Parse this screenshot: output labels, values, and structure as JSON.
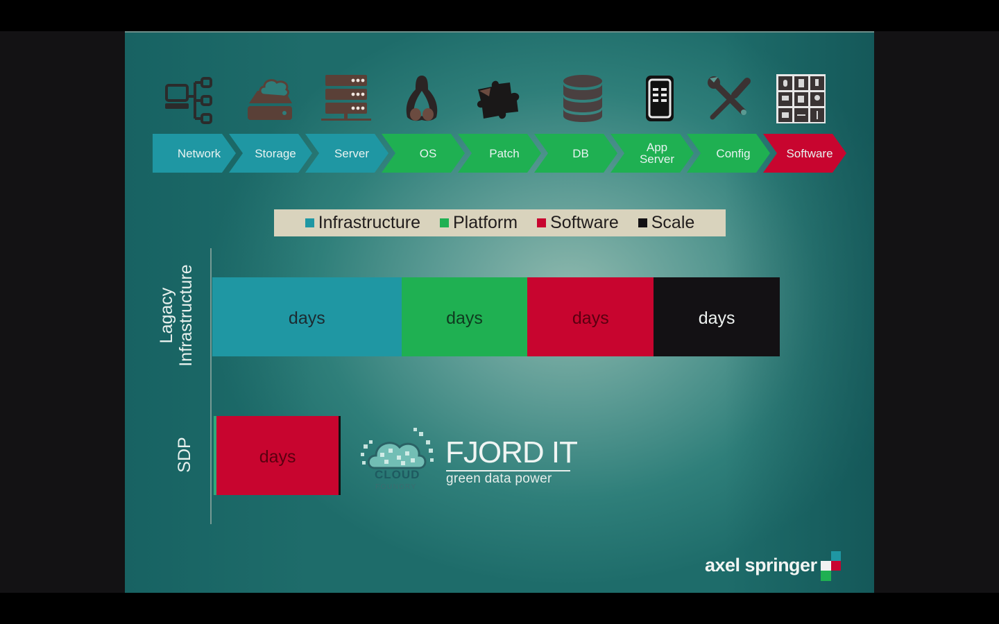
{
  "slide": {
    "process_steps": [
      {
        "label": "Network",
        "icon": "network-tree-icon",
        "category": "Infrastructure"
      },
      {
        "label": "Storage",
        "icon": "cloud-storage-icon",
        "category": "Infrastructure"
      },
      {
        "label": "Server",
        "icon": "server-rack-icon",
        "category": "Infrastructure"
      },
      {
        "label": "OS",
        "icon": "linux-penguin-icon",
        "category": "Platform"
      },
      {
        "label": "Patch",
        "icon": "puzzle-piece-icon",
        "category": "Platform"
      },
      {
        "label": "DB",
        "icon": "database-icon",
        "category": "Platform"
      },
      {
        "label_line1": "App",
        "label_line2": "Server",
        "icon": "mobile-app-icon",
        "category": "Platform"
      },
      {
        "label": "Config",
        "icon": "wrench-screwdriver-icon",
        "category": "Platform"
      },
      {
        "label": "Software",
        "icon": "app-grid-icon",
        "category": "Software"
      }
    ],
    "logos": {
      "cloud_foundry_line1": "CLOUD",
      "cloud_foundry_line2": "FOUNDRY",
      "fjord_title": "FJORD IT",
      "fjord_tagline": "green data power",
      "publisher": "axel springer"
    },
    "colors": {
      "infrastructure": "#1f97a3",
      "platform": "#1fb052",
      "software": "#c8052f",
      "scale": "#131114"
    }
  },
  "chart_data": {
    "type": "bar",
    "orientation": "horizontal-stacked",
    "title": "",
    "legend": {
      "position": "top",
      "entries": [
        "Infrastructure",
        "Platform",
        "Software",
        "Scale"
      ]
    },
    "categories": [
      "Lagacy Infrastructure",
      "SDP"
    ],
    "category_lines": [
      [
        "Lagacy",
        "Infrastructure"
      ],
      [
        "SDP"
      ]
    ],
    "series": [
      {
        "name": "Infrastructure",
        "color": "#1f97a3",
        "values": [
          1.5,
          0
        ],
        "labels": [
          "days",
          ""
        ]
      },
      {
        "name": "Platform",
        "color": "#1fb052",
        "values": [
          1.0,
          0
        ],
        "labels": [
          "days",
          ""
        ]
      },
      {
        "name": "Software",
        "color": "#c8052f",
        "values": [
          1.0,
          1.0
        ],
        "labels": [
          "days",
          "days"
        ]
      },
      {
        "name": "Scale",
        "color": "#131114",
        "values": [
          1.0,
          0
        ],
        "labels": [
          "days",
          ""
        ]
      }
    ],
    "value_unit": "relative duration (labelled 'days')",
    "xlim": [
      0,
      4.5
    ],
    "grid": false
  }
}
